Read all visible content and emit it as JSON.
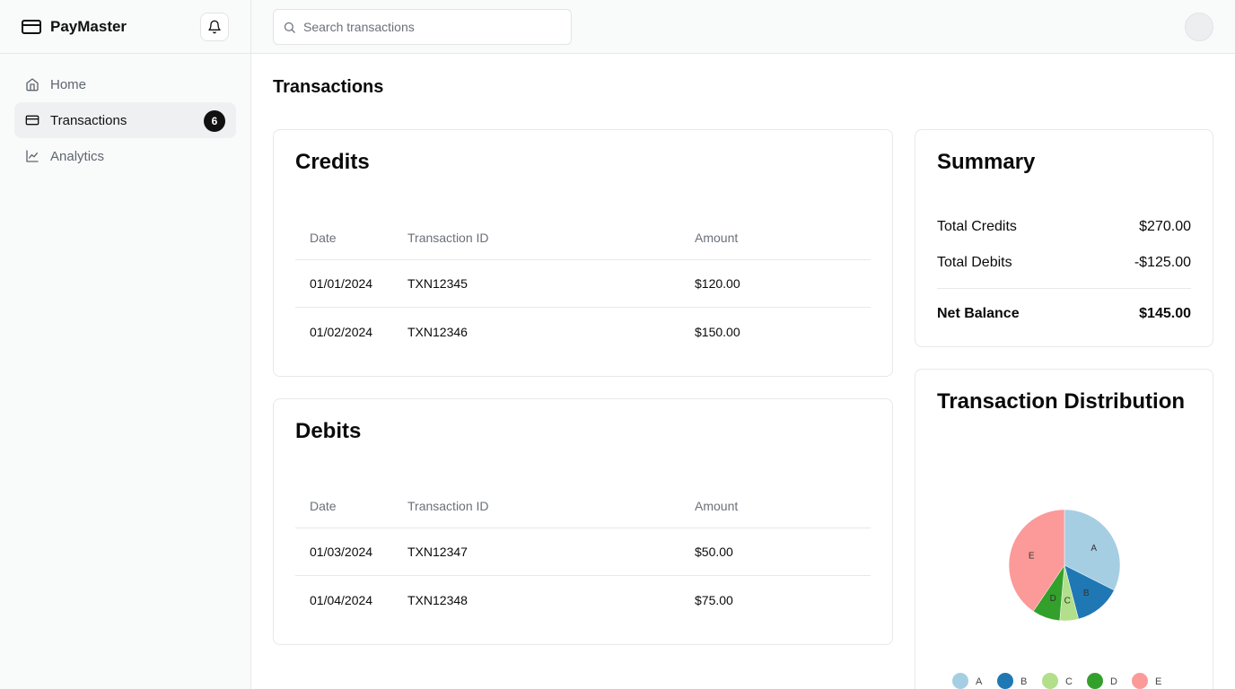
{
  "app": {
    "name": "PayMaster"
  },
  "sidebar": {
    "items": [
      {
        "label": "Home",
        "icon": "home-icon"
      },
      {
        "label": "Transactions",
        "icon": "card-icon",
        "badge": "6",
        "active": true
      },
      {
        "label": "Analytics",
        "icon": "line-chart-icon"
      }
    ]
  },
  "search": {
    "placeholder": "Search transactions",
    "value": ""
  },
  "page": {
    "title": "Transactions"
  },
  "credits": {
    "title": "Credits",
    "columns": [
      "Date",
      "Transaction ID",
      "Amount"
    ],
    "rows": [
      {
        "date": "01/01/2024",
        "id": "TXN12345",
        "amount": "$120.00"
      },
      {
        "date": "01/02/2024",
        "id": "TXN12346",
        "amount": "$150.00"
      }
    ]
  },
  "debits": {
    "title": "Debits",
    "columns": [
      "Date",
      "Transaction ID",
      "Amount"
    ],
    "rows": [
      {
        "date": "01/03/2024",
        "id": "TXN12347",
        "amount": "$50.00"
      },
      {
        "date": "01/04/2024",
        "id": "TXN12348",
        "amount": "$75.00"
      }
    ]
  },
  "summary": {
    "title": "Summary",
    "total_credits_label": "Total Credits",
    "total_credits": "$270.00",
    "total_debits_label": "Total Debits",
    "total_debits": "-$125.00",
    "net_label": "Net Balance",
    "net": "$145.00"
  },
  "distribution": {
    "title": "Transaction Distribution"
  },
  "chart_data": {
    "type": "pie",
    "categories": [
      "A",
      "B",
      "C",
      "D",
      "E"
    ],
    "values": [
      120,
      50,
      20,
      30,
      150
    ],
    "colors": [
      "#a6cee3",
      "#1f78b4",
      "#b2df8a",
      "#33a02c",
      "#fb9a99"
    ],
    "legend": "bottom"
  }
}
